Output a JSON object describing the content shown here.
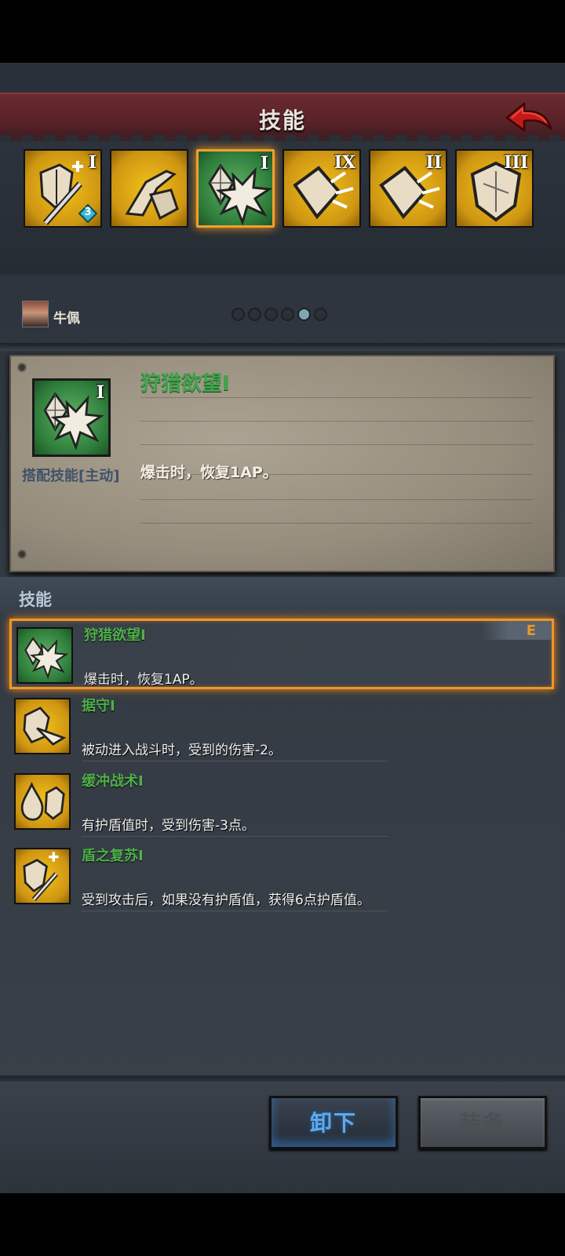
{
  "header": {
    "title": "技能"
  },
  "skill_slots": [
    {
      "numeral": "I",
      "color": "yellow",
      "icon": "shield-sword-plus-icon",
      "badge": "3"
    },
    {
      "numeral": "",
      "color": "yellow",
      "icon": "arm-shield-icon"
    },
    {
      "numeral": "I",
      "color": "green",
      "icon": "crystal-burst-icon",
      "selected": true
    },
    {
      "numeral": "IX",
      "color": "yellow",
      "icon": "shield-impact-icon"
    },
    {
      "numeral": "II",
      "color": "yellow",
      "icon": "shield-impact-icon"
    },
    {
      "numeral": "III",
      "color": "yellow",
      "icon": "shield-icon"
    }
  ],
  "character": {
    "name": "牛佩"
  },
  "pagination": {
    "count": 6,
    "active_index": 4
  },
  "detail": {
    "name": "狩猎欲望I",
    "numeral": "I",
    "tag": "搭配技能[主动]",
    "description": "爆击时，恢复1AP。"
  },
  "section": {
    "title": "技能"
  },
  "skills": [
    {
      "name": "狩猎欲望I",
      "desc": "爆击时，恢复1AP。",
      "color": "green",
      "icon": "crystal-burst-icon",
      "equipped_mark": "E",
      "selected": true
    },
    {
      "name": "据守I",
      "desc": "被动进入战斗时，受到的伤害-2。",
      "color": "yellow",
      "icon": "shield-arrow-icon"
    },
    {
      "name": "缓冲战术I",
      "desc": "有护盾值时，受到伤害-3点。",
      "color": "yellow",
      "icon": "drop-shield-icon"
    },
    {
      "name": "盾之复苏I",
      "desc": "受到攻击后，如果没有护盾值，获得6点护盾值。",
      "color": "yellow",
      "icon": "shield-spear-plus-icon"
    }
  ],
  "buttons": {
    "unequip": "卸下",
    "equip": "装备"
  },
  "colors": {
    "accent_orange": "#f0962a",
    "skill_name_green": "#4fb04a",
    "unequip_blue": "#5fa8ee"
  }
}
